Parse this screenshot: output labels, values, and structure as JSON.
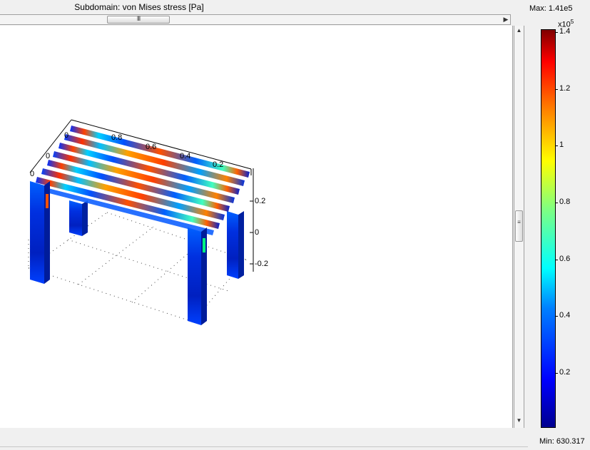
{
  "window": {
    "plot_title": "Subdomain: von Mises stress [Pa]"
  },
  "scrollbars": {
    "horizontal_grip": "III",
    "right_arrow": "▶",
    "up_arrow": "▲",
    "down_arrow": "▼",
    "vertical_grip": "≡"
  },
  "colorbar": {
    "max_label": "Max: 1.41e5",
    "min_label": "Min: 630.317",
    "scale_base": "x10",
    "scale_exp": "5",
    "ticks": [
      {
        "label": "1.4",
        "value": 1.4
      },
      {
        "label": "1.2",
        "value": 1.2
      },
      {
        "label": "1",
        "value": 1.0
      },
      {
        "label": "0.8",
        "value": 0.8
      },
      {
        "label": "0.6",
        "value": 0.6
      },
      {
        "label": "0.4",
        "value": 0.4
      },
      {
        "label": "0.2",
        "value": 0.2
      }
    ],
    "range": [
      0.0063,
      1.41
    ]
  },
  "plot": {
    "top_axis_labels": [
      "0.8",
      "0.6",
      "0.4",
      "0.2"
    ],
    "left_axis_labels": [
      "0",
      "0",
      "0"
    ],
    "z_axis_labels": [
      "0.2",
      "0",
      "-0.2"
    ],
    "colors": {
      "low": "#0000c8",
      "mid": "#00e0ff",
      "high": "#ff3000"
    }
  }
}
